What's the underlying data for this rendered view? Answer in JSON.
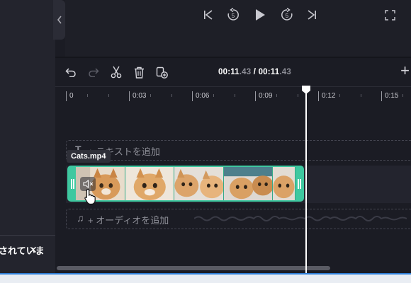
{
  "player": {
    "controls": [
      "skip-back-icon",
      "rewind-5-icon",
      "play-icon",
      "forward-5-icon",
      "skip-forward-icon",
      "fullscreen-icon"
    ]
  },
  "toolbar": {
    "timecode": {
      "current_main": "00:11",
      "current_frac": ".43",
      "separator": " / ",
      "total_main": "00:11",
      "total_frac": ".43"
    }
  },
  "ruler": {
    "ticks": [
      "0",
      "0:03",
      "0:06",
      "0:09",
      "0:12",
      "0:15"
    ]
  },
  "tracks": {
    "text_placeholder": "+ テキストを追加",
    "audio_placeholder": "+ オーディオを追加",
    "clip_name": "Cats.mp4"
  },
  "sidebar": {
    "toast_text": "されていま"
  },
  "colors": {
    "accent": "#3ec8a0",
    "background": "#1b1c24"
  }
}
